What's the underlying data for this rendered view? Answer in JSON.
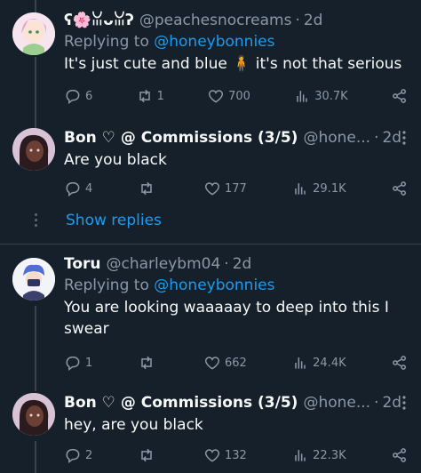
{
  "tweets": [
    {
      "name": "ʕ🌸ꈍᴗꈍʔ",
      "handle": "@peachesnocreams",
      "time": "2d",
      "replying_to": "Replying to",
      "reply_link": "@honeybonnies",
      "text": "It's just cute and blue 🧍 it's not that serious",
      "replies": "6",
      "retweets": "1",
      "likes": "700",
      "views": "30.7K"
    },
    {
      "name": "Bon ♡ @ Commissions (3/5)",
      "handle": "@hone...",
      "time": "2d",
      "text": "Are you black",
      "replies": "4",
      "retweets": "",
      "likes": "177",
      "views": "29.1K"
    },
    {
      "name": "Toru",
      "handle": "@charleybm04",
      "time": "2d",
      "replying_to": "Replying to",
      "reply_link": "@honeybonnies",
      "text": "You are looking waaaaay to deep into this I swear",
      "replies": "1",
      "retweets": "",
      "likes": "662",
      "views": "24.4K"
    },
    {
      "name": "Bon ♡ @ Commissions (3/5)",
      "handle": "@hone...",
      "time": "2d",
      "text": "hey, are you black",
      "replies": "2",
      "retweets": "",
      "likes": "132",
      "views": "22.3K"
    }
  ],
  "show_replies": "Show replies",
  "dot": "·",
  "icons": [
    "reply-icon",
    "retweet-icon",
    "like-icon",
    "views-icon",
    "share-icon",
    "more-icon"
  ],
  "colors": {
    "background": "#15202b",
    "link": "#1d9bf0",
    "muted": "#8b98a5",
    "border": "#38444d"
  }
}
